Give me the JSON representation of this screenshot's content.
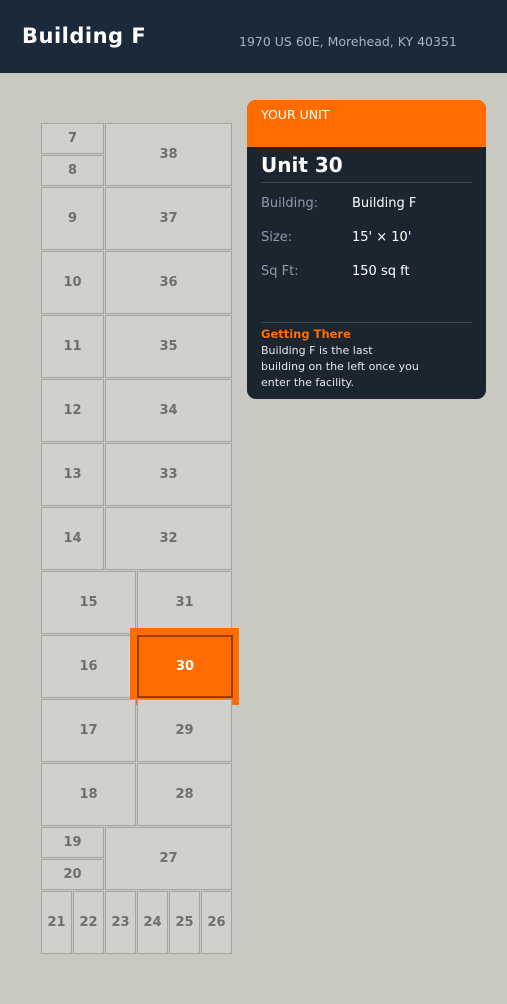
{
  "header": {
    "title": "Building F",
    "address": "1970 US 60E, Morehead, KY 40351"
  },
  "map": {
    "units": [
      "7",
      "8",
      "38",
      "9",
      "37",
      "10",
      "36",
      "11",
      "35",
      "12",
      "34",
      "13",
      "33",
      "14",
      "32",
      "15",
      "31",
      "16",
      "30",
      "17",
      "29",
      "18",
      "28",
      "19",
      "20",
      "27",
      "21",
      "22",
      "23",
      "24",
      "25",
      "26"
    ],
    "highlighted_unit": "30"
  },
  "card": {
    "band_label": "YOUR UNIT",
    "unit_title": "Unit 30",
    "details": [
      {
        "key": "Building:",
        "value": "Building F"
      },
      {
        "key": "Size:",
        "value": "15' × 10'"
      },
      {
        "key": "Sq Ft:",
        "value": "150 sq ft"
      }
    ],
    "getting_there_title": "Getting There",
    "getting_there_lines": [
      "Building F is the last",
      "building on the left once you",
      "enter the facility."
    ]
  },
  "colors": {
    "header_bg": "#1b2a3b",
    "accent": "#ff6d00",
    "card_bg": "#1b2530",
    "unit_fill": "#d0d0cc",
    "page_bg": "#c9c9c1"
  }
}
